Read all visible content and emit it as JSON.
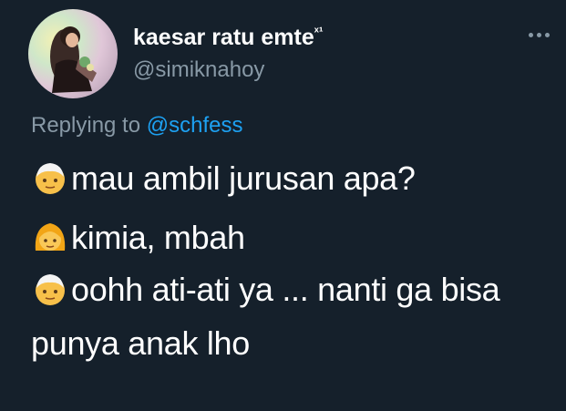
{
  "user": {
    "display_name": "kaesar ratu emte",
    "name_suffix": "ˣ¹",
    "handle": "@simiknahoy"
  },
  "reply": {
    "prefix": "Replying to ",
    "mention": "@schfess"
  },
  "tweet": {
    "lines": [
      {
        "emoji": "older-man-emoji",
        "text": "mau ambil jurusan apa?"
      },
      {
        "emoji": "woman-blond-emoji",
        "text": "kimia, mbah"
      },
      {
        "emoji": "older-man-emoji",
        "text": "oohh ati-ati ya ... nanti ga bisa"
      },
      {
        "emoji": "",
        "text": "punya anak lho"
      }
    ]
  },
  "colors": {
    "background": "#15202b",
    "text": "#ffffff",
    "muted": "#8899a6",
    "link": "#1da1f2"
  },
  "icons": {
    "more": "more-dots-icon"
  }
}
